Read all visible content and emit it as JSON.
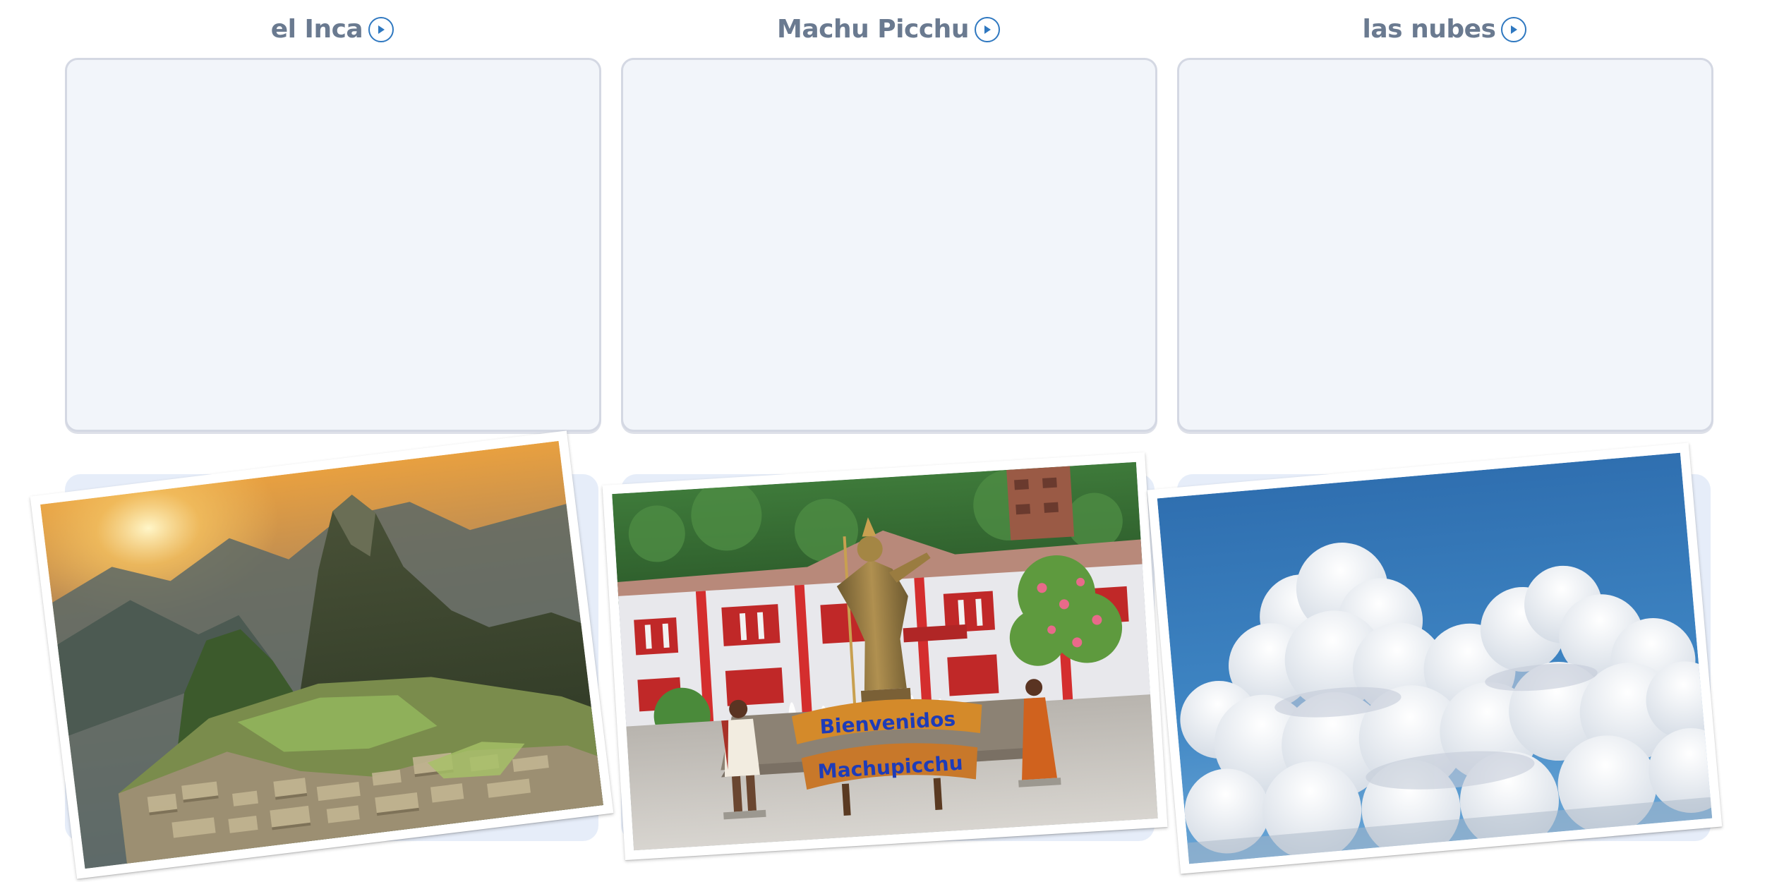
{
  "categories": [
    {
      "label": "el Inca",
      "play_icon": "play-icon"
    },
    {
      "label": "Machu Picchu",
      "play_icon": "play-icon"
    },
    {
      "label": "las nubes",
      "play_icon": "play-icon"
    }
  ],
  "cards": [
    {
      "name": "machu-picchu-ruins-photo",
      "description": "Machu Picchu citadel with Huayna Picchu mountain at sunset"
    },
    {
      "name": "inca-statue-plaza-photo",
      "description": "Inca statue with Bienvenidos Machupicchu sign in town plaza"
    },
    {
      "name": "clouds-photo",
      "description": "White cumulus clouds in a blue sky"
    }
  ],
  "card_sign_text": [
    "Bienvenidos",
    "Machupicchu"
  ],
  "colors": {
    "label_text": "#6a7a90",
    "play_accent": "#2f78c0",
    "drop_box_fill": "#f2f5fa",
    "drop_box_border": "#d4d8e3",
    "tray_fill": "#e6edf9"
  }
}
